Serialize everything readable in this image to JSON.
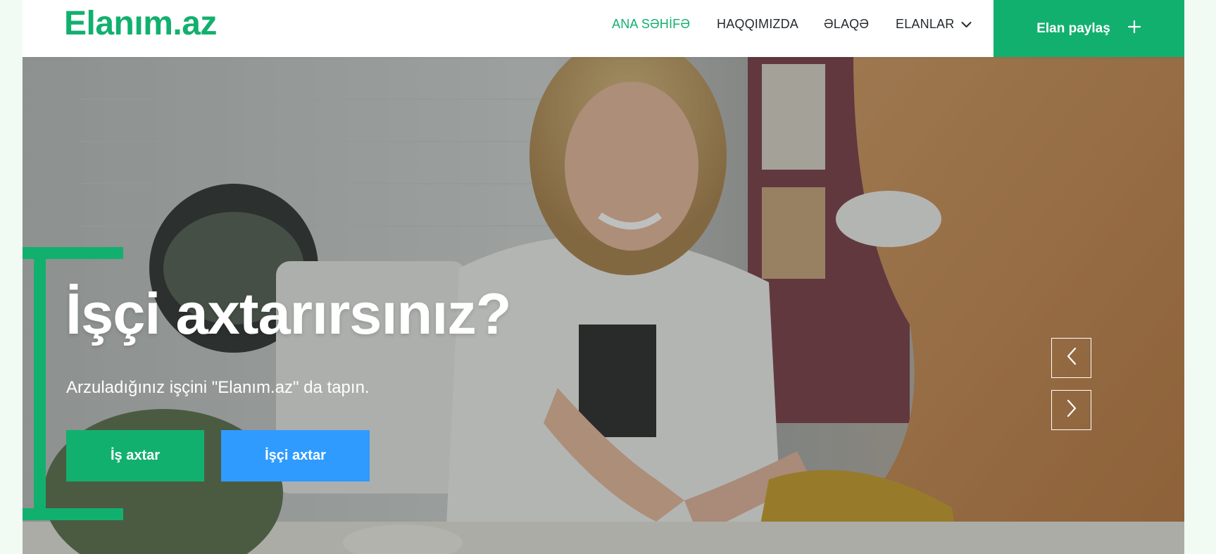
{
  "brand": {
    "logo": "Elanım.az",
    "accent": "#12b06e",
    "secondary": "#2f9bff"
  },
  "nav": {
    "items": [
      {
        "label": "ANA SƏHİFƏ",
        "active": true
      },
      {
        "label": "HAQQIMIZDA",
        "active": false
      },
      {
        "label": "ƏLAQƏ",
        "active": false
      },
      {
        "label": "ELANLAR",
        "active": false,
        "icon": "chevron-down-icon"
      }
    ],
    "post_button": {
      "label": "Elan paylaş",
      "icon": "plus-icon"
    }
  },
  "hero": {
    "title": "İşçi axtarırsınız?",
    "subtitle": "Arzuladığınız işçini \"Elanım.az\" da tapın.",
    "primary_button": "İş axtar",
    "secondary_button": "İşçi axtar",
    "prev_icon": "chevron-left-icon",
    "next_icon": "chevron-right-icon"
  }
}
